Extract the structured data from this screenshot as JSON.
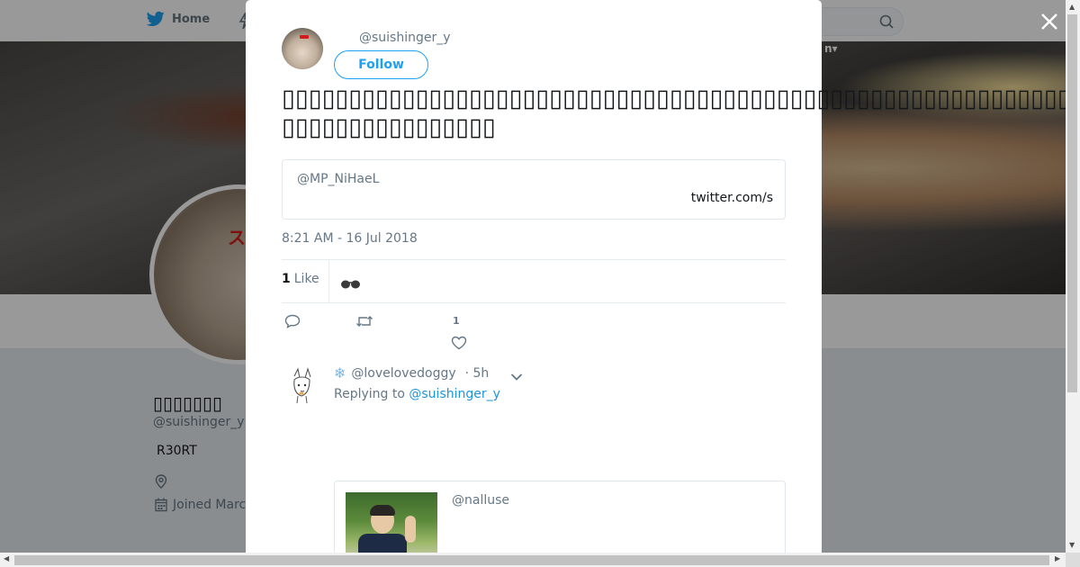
{
  "nav": {
    "home_label": "Home",
    "banner_menu_fragment": "n▾"
  },
  "profile": {
    "name": "▯▯▯▯▯▯▯",
    "handle": "@suishinger_y",
    "bio": "R30RT",
    "joined": "Joined March",
    "avatar_text": "ス"
  },
  "tweet": {
    "handle": "@suishinger_y",
    "follow_label": "Follow",
    "text": "▯▯▯▯▯▯▯▯▯▯▯▯▯▯▯▯▯▯▯▯▯▯▯▯▯▯▯▯▯▯▯▯▯▯▯▯▯▯▯▯▯▯▯▯▯▯▯▯▯▯▯▯▯▯▯▯▯▯▯▯▯▯▯▯▯▯▯▯▯▯▯▯▯▯▯",
    "quote": {
      "handle": "@MP_NiHaeL",
      "link": "twitter.com/s"
    },
    "timestamp": "8:21 AM - 16 Jul 2018",
    "likes_count": "1",
    "likes_label": "Like",
    "like_action_count": "1"
  },
  "reply": {
    "handle": "@lovelovedoggy",
    "time": "· 5h",
    "replying_prefix": "Replying to",
    "replying_to": "@suishinger_y",
    "card_handle": "@nalluse"
  }
}
